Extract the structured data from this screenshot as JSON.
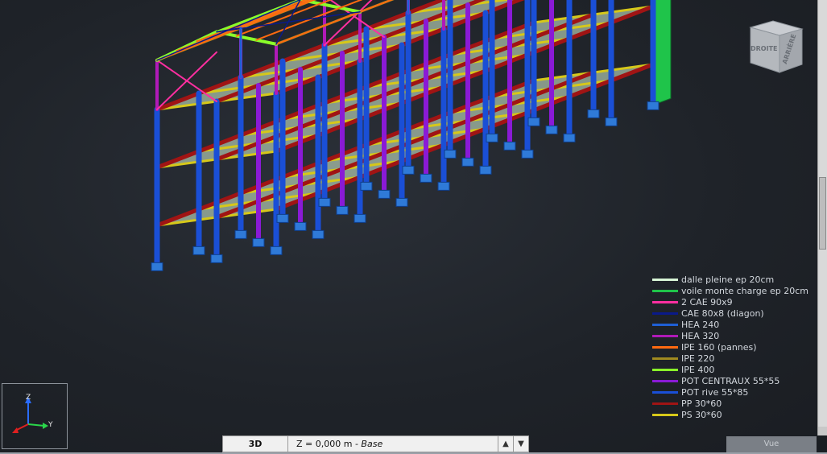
{
  "viewport": {
    "view_name": "3D"
  },
  "viewcube": {
    "face_left": "DROITE",
    "face_right": "ARRIÈRE"
  },
  "ucs": {
    "z_label": "Z",
    "y_label": "Y"
  },
  "legend": {
    "items": [
      {
        "label": "dalle pleine ep 20cm",
        "color": "#d8f5d6"
      },
      {
        "label": "voile monte charge ep 20cm",
        "color": "#1fc44a"
      },
      {
        "label": "2 CAE 90x9",
        "color": "#ff2fa0"
      },
      {
        "label": "CAE 80x8 (diagon)",
        "color": "#0a1a8a"
      },
      {
        "label": "HEA 240",
        "color": "#1f5fd6"
      },
      {
        "label": "HEA 320",
        "color": "#b01ab8"
      },
      {
        "label": "IPE 160 (pannes)",
        "color": "#ff6a10"
      },
      {
        "label": "IPE 220",
        "color": "#a08a20"
      },
      {
        "label": "IPE 400",
        "color": "#8aff2a"
      },
      {
        "label": "POT CENTRAUX 55*55",
        "color": "#8a1ad6"
      },
      {
        "label": "POT rive 55*85",
        "color": "#1a4fd6"
      },
      {
        "label": "PP 30*60",
        "color": "#a01414"
      },
      {
        "label": "PS 30*60",
        "color": "#d6c81a"
      }
    ]
  },
  "statusbar": {
    "view_label": "3D",
    "level_prefix": "Z = 0,000 m - ",
    "level_name": "Base",
    "up_arrow": "▲",
    "down_arrow": "▼"
  },
  "tab": {
    "label": "Vue"
  }
}
